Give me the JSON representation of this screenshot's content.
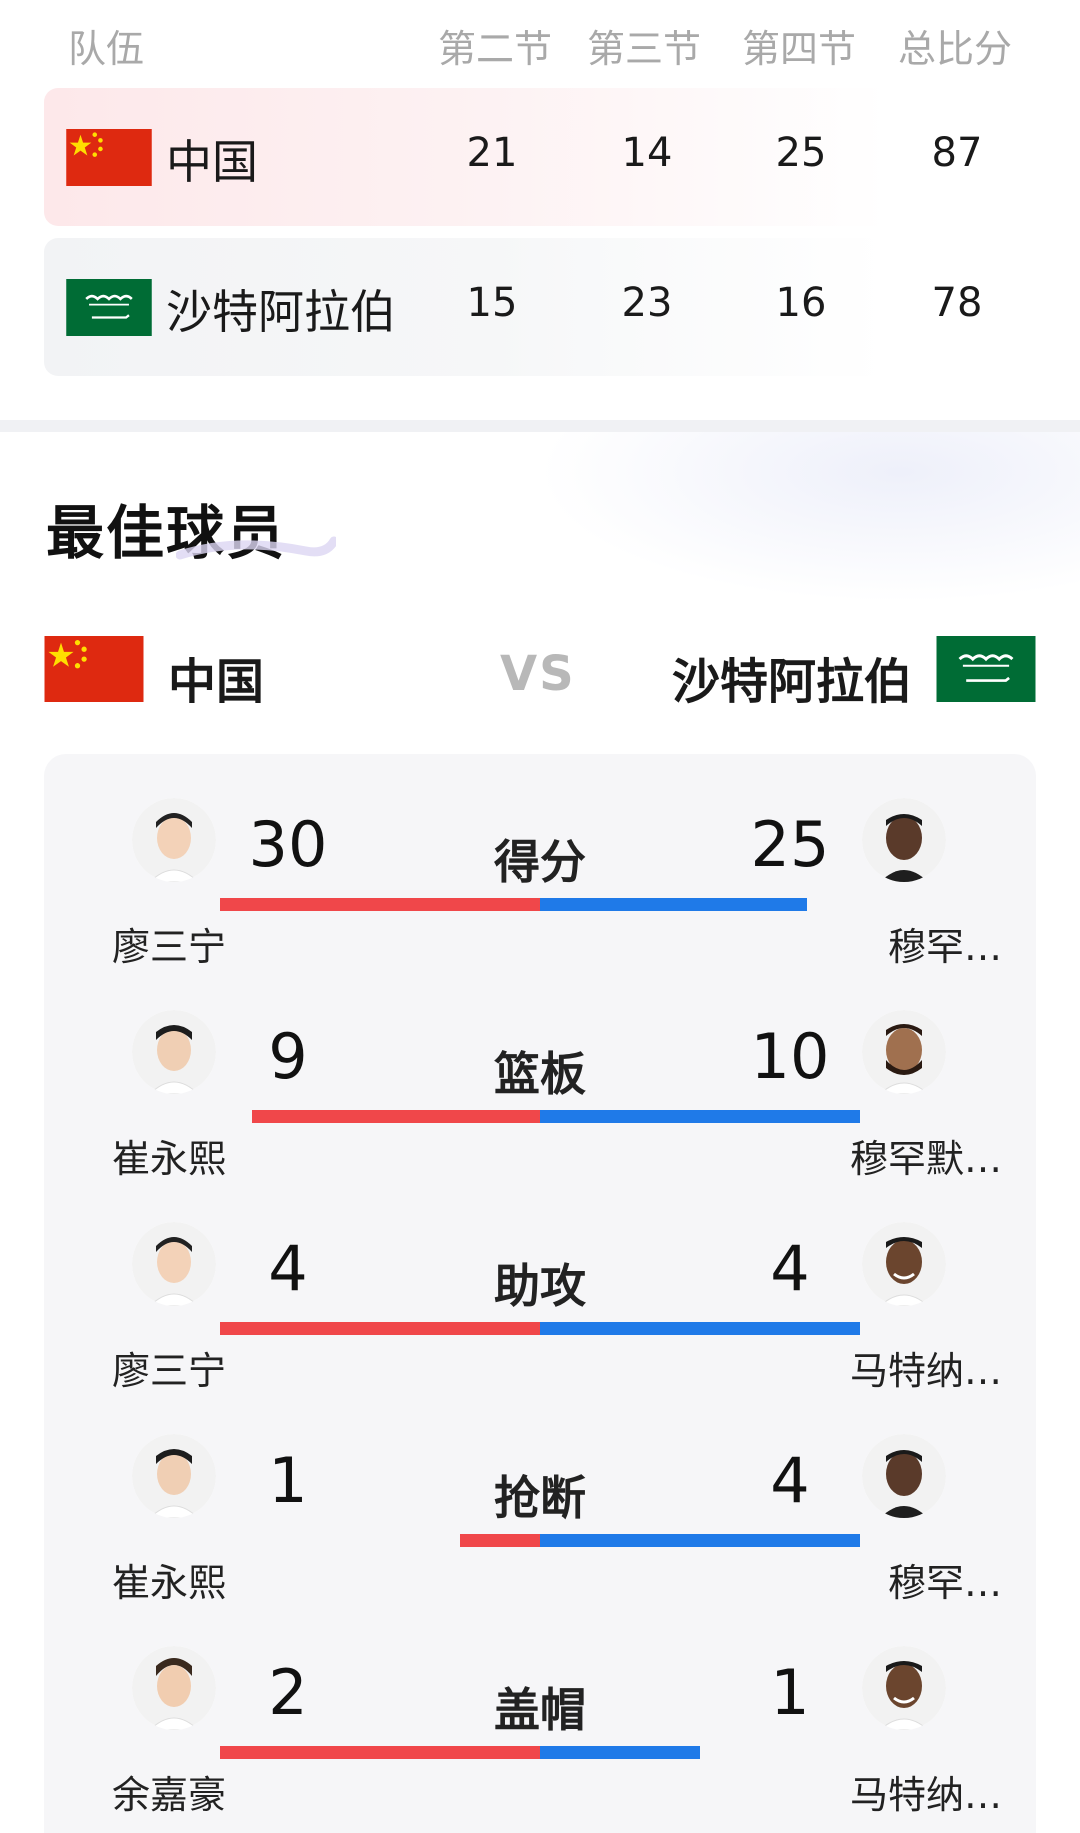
{
  "score_table": {
    "headers": {
      "team": "队伍",
      "q2": "第二节",
      "q3": "第三节",
      "q4": "第四节",
      "total": "总比分"
    },
    "rows": [
      {
        "team": "中国",
        "flag": "china-flag",
        "q2": "21",
        "q3": "14",
        "q4": "25",
        "total": "87"
      },
      {
        "team": "沙特阿拉伯",
        "flag": "saudi-flag",
        "q2": "15",
        "q3": "23",
        "q4": "16",
        "total": "78"
      }
    ]
  },
  "best_players": {
    "title": "最佳球员",
    "home_team": "中国",
    "vs": "VS",
    "away_team": "沙特阿拉伯",
    "stats": [
      {
        "label": "得分",
        "home_value": "30",
        "away_value": "25",
        "home_player": "廖三宁",
        "away_player": "穆罕…"
      },
      {
        "label": "篮板",
        "home_value": "9",
        "away_value": "10",
        "home_player": "崔永熙",
        "away_player": "穆罕默…"
      },
      {
        "label": "助攻",
        "home_value": "4",
        "away_value": "4",
        "home_player": "廖三宁",
        "away_player": "马特纳…"
      },
      {
        "label": "抢断",
        "home_value": "1",
        "away_value": "4",
        "home_player": "崔永熙",
        "away_player": "穆罕…"
      },
      {
        "label": "盖帽",
        "home_value": "2",
        "away_value": "1",
        "home_player": "余嘉豪",
        "away_player": "马特纳…"
      }
    ]
  },
  "colors": {
    "home_bar": "#f0474a",
    "away_bar": "#1f7ae8",
    "header_text": "#a9a9a9"
  }
}
